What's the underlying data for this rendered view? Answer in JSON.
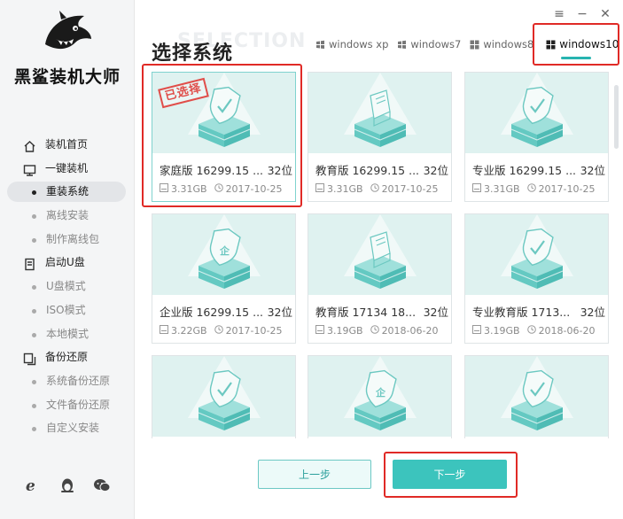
{
  "app": {
    "name": "黑鲨装机大师"
  },
  "sidebar": {
    "items": [
      {
        "label": "装机首页",
        "kind": "group",
        "icon": "home-icon"
      },
      {
        "label": "一键装机",
        "kind": "group",
        "icon": "monitor-icon"
      },
      {
        "label": "重装系统",
        "kind": "sub",
        "active": true
      },
      {
        "label": "离线安装",
        "kind": "sub"
      },
      {
        "label": "制作离线包",
        "kind": "sub"
      },
      {
        "label": "启动U盘",
        "kind": "group",
        "icon": "usb-icon"
      },
      {
        "label": "U盘模式",
        "kind": "sub"
      },
      {
        "label": "ISO模式",
        "kind": "sub"
      },
      {
        "label": "本地模式",
        "kind": "sub"
      },
      {
        "label": "备份还原",
        "kind": "group",
        "icon": "backup-icon"
      },
      {
        "label": "系统备份还原",
        "kind": "sub"
      },
      {
        "label": "文件备份还原",
        "kind": "sub"
      },
      {
        "label": "自定义安装",
        "kind": "sub"
      }
    ],
    "footer_icons": [
      "ie-browser-icon",
      "qq-penguin-icon",
      "wechat-icon"
    ]
  },
  "header": {
    "title": "选择系统",
    "title_watermark": "SELECTION",
    "window_controls": [
      "menu-icon",
      "minimize-icon",
      "close-icon"
    ]
  },
  "tabs": [
    {
      "label": "windows xp",
      "active": false
    },
    {
      "label": "windows7",
      "active": false
    },
    {
      "label": "windows8",
      "active": false
    },
    {
      "label": "windows10",
      "active": true
    }
  ],
  "cards": [
    {
      "name": "家庭版 16299.15 ...",
      "arch": "32位",
      "size": "3.31GB",
      "date": "2017-10-25",
      "selected": true,
      "icon": "check-shield-icon"
    },
    {
      "name": "教育版 16299.15 ...",
      "arch": "32位",
      "size": "3.31GB",
      "date": "2017-10-25",
      "selected": false,
      "icon": "book-icon"
    },
    {
      "name": "专业版 16299.15 ...",
      "arch": "32位",
      "size": "3.31GB",
      "date": "2017-10-25",
      "selected": false,
      "icon": "check-shield-icon"
    },
    {
      "name": "企业版 16299.15 ...",
      "arch": "32位",
      "size": "3.22GB",
      "date": "2017-10-25",
      "selected": false,
      "icon": "enterprise-shield-icon"
    },
    {
      "name": "教育版 17134 18...",
      "arch": "32位",
      "size": "3.19GB",
      "date": "2018-06-20",
      "selected": false,
      "icon": "book-icon"
    },
    {
      "name": "专业教育版 1713...",
      "arch": "32位",
      "size": "3.19GB",
      "date": "2018-06-20",
      "selected": false,
      "icon": "check-shield-icon"
    },
    {
      "name": "",
      "arch": "",
      "size": "",
      "date": "",
      "selected": false,
      "icon": "check-shield-icon"
    },
    {
      "name": "",
      "arch": "",
      "size": "",
      "date": "",
      "selected": false,
      "icon": "enterprise-shield-icon"
    },
    {
      "name": "",
      "arch": "",
      "size": "",
      "date": "",
      "selected": false,
      "icon": "check-shield-icon"
    }
  ],
  "selected_stamp": "已选择",
  "buttons": {
    "prev": "上一步",
    "next": "下一步"
  },
  "colors": {
    "accent": "#3cc4bd",
    "highlight": "#e02a26",
    "card_bg": "#dff2f0"
  }
}
